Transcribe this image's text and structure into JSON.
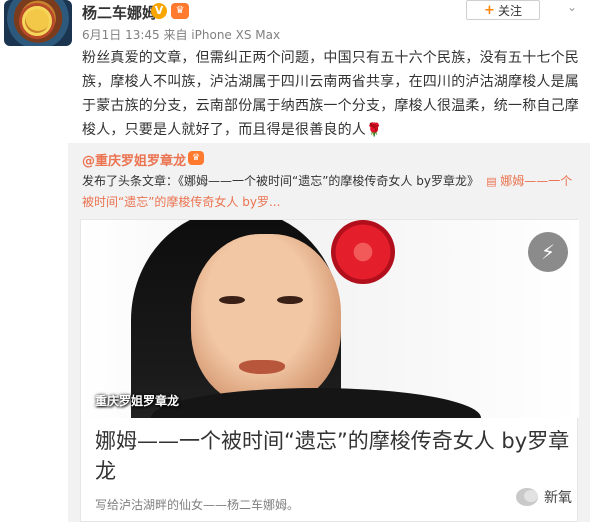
{
  "post": {
    "username": "杨二车娜姆",
    "verified_badge": "V",
    "vip_badge": "♛",
    "meta": "6月1日 13:45 来自 iPhone XS Max",
    "follow_label": "关注",
    "follow_icon": "+",
    "menu_icon": "chevron-down-icon",
    "body": "粉丝真爱的文章，但需纠正两个问题，中国只有五十六个民族，没有五十七个民族，摩梭人不叫族，泸沽湖属于四川云南两省共享，在四川的泸沽湖摩梭人是属于蒙古族的分支，云南部份属于纳西族一个分支，摩梭人很温柔，统一称自己摩梭人，只要是人就好了，而且得是很善良的人",
    "emoji": "🌹"
  },
  "repost": {
    "username": "@重庆罗姐罗章龙",
    "vip_badge": "♛",
    "text_prefix": "发布了头条文章：《娜姆——一个被时间“遗忘”的摩梭传奇女人 by罗章龙》",
    "link_text": "娜姆——一个被时间“遗忘”的摩梭传奇女人 by罗...",
    "card": {
      "cover_caption": "重庆罗姐罗章龙",
      "title": "娜姆——一个被时间“遗忘”的摩梭传奇女人 by罗章龙",
      "description": "写给泸沽湖畔的仙女——杨二车娜姆。"
    }
  },
  "watermark": {
    "text": "新氧"
  },
  "colors": {
    "accent": "#eb7350",
    "follow_plus": "#ff8200",
    "repost_bg": "#f2f2f2"
  }
}
